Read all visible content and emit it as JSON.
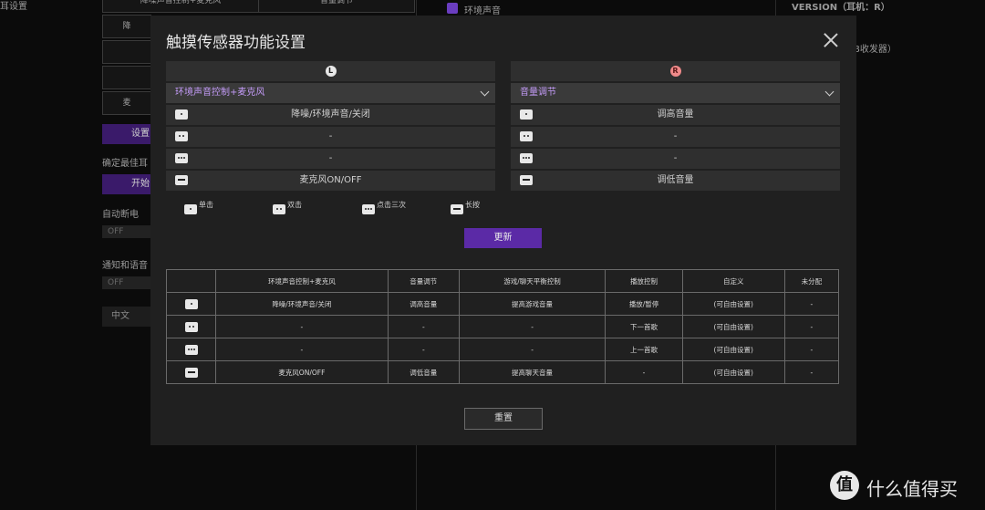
{
  "background": {
    "top_left_label": "耳设置",
    "grid_cells": [
      "降噪声音控制+麦克风",
      "音量调节",
      "降",
      "",
      "",
      "麦"
    ],
    "settings_button": "设置",
    "fit_label": "确定最佳耳",
    "start_button": "开始",
    "auto_off_label": "自动断电",
    "auto_off_toggle": "OFF",
    "notify_label": "通知和语音",
    "notify_toggle": "OFF",
    "language": "中文",
    "ambient_checkbox": "环境声音",
    "version": "VERSION（耳机：R）",
    "receiver": "B收发器）"
  },
  "modal": {
    "title": "触摸传感器功能设置",
    "left": {
      "side": "L",
      "selected": "环境声音控制+麦克风",
      "rows": [
        "降噪/环境声音/关闭",
        "-",
        "-",
        "麦克风ON/OFF"
      ]
    },
    "right": {
      "side": "R",
      "selected": "音量调节",
      "rows": [
        "调高音量",
        "-",
        "-",
        "调低音量"
      ]
    },
    "legend": {
      "single": "单击",
      "double": "双击",
      "triple": "点击三次",
      "long": "长按"
    },
    "update_button": "更新",
    "table": {
      "headers": [
        "",
        "环境声音控制+麦克风",
        "音量调节",
        "游戏/聊天平衡控制",
        "播放控制",
        "自定义",
        "未分配"
      ],
      "rows": [
        {
          "gesture": "single",
          "cells": [
            "降噪/环境声音/关闭",
            "调高音量",
            "提高游戏音量",
            "播放/暂停",
            "(可自由设置)",
            "-"
          ]
        },
        {
          "gesture": "double",
          "cells": [
            "-",
            "-",
            "-",
            "下一首歌",
            "(可自由设置)",
            "-"
          ]
        },
        {
          "gesture": "triple",
          "cells": [
            "-",
            "-",
            "-",
            "上一首歌",
            "(可自由设置)",
            "-"
          ]
        },
        {
          "gesture": "long",
          "cells": [
            "麦克风ON/OFF",
            "调低音量",
            "提高聊天音量",
            "-",
            "(可自由设置)",
            "-"
          ]
        }
      ]
    },
    "reset_button": "重置"
  },
  "watermark": {
    "logo": "值",
    "text": "什么值得买"
  },
  "colors": {
    "accent_purple": "#5b2aa6",
    "select_text": "#c39bf7",
    "badge_left": "#e8e8e8",
    "badge_right": "#f08a8a"
  }
}
